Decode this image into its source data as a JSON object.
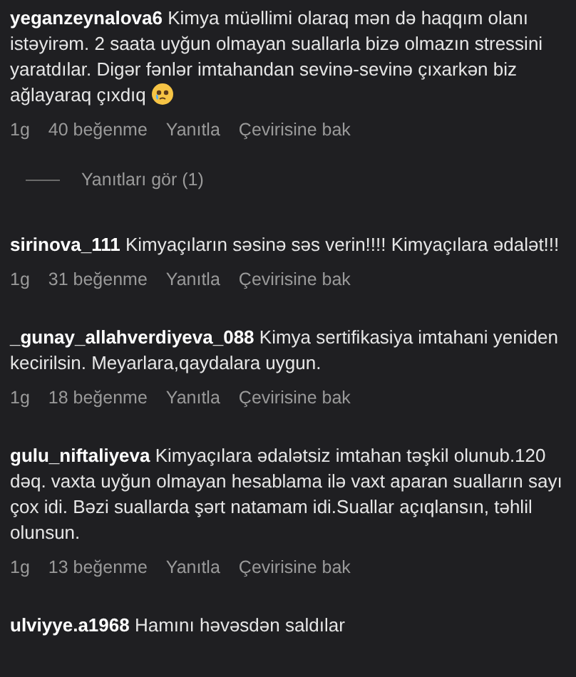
{
  "comments": [
    {
      "username": "yeganzeynalova6",
      "text": "Kimya müəllimi olaraq mən də haqqım olanı istəyirəm. 2 saata uyğun olmayan suallarla bizə olmazın stressini yaratdılar. Digər fənlər imtahandan sevinə-sevinə çıxarkən biz ağlayaraq çıxdıq",
      "trailing_emoji": true,
      "time": "1g",
      "likes": "40 beğenme",
      "reply": "Yanıtla",
      "translate": "Çevirisine bak",
      "replies_link": "Yanıtları gör (1)"
    },
    {
      "username": "sirinova_111",
      "text": "Kimyaçıların səsinə səs verin!!!! Kimyaçılara ədalət!!!",
      "time": "1g",
      "likes": "31 beğenme",
      "reply": "Yanıtla",
      "translate": "Çevirisine bak"
    },
    {
      "username": "_gunay_allahverdiyeva_088",
      "text": "Kimya sertifikasiya imtahani yeniden kecirilsin. Meyarlara,qaydalara uygun.",
      "time": "1g",
      "likes": "18 beğenme",
      "reply": "Yanıtla",
      "translate": "Çevirisine bak"
    },
    {
      "username": "gulu_niftaliyeva",
      "text": "Kimyaçılara ədalətsiz imtahan təşkil olunub.120 dəq. vaxta uyğun olmayan hesablama ilə vaxt aparan sualların sayı çox idi. Bəzi suallarda şərt natamam idi.Suallar açıqlansın, təhlil olunsun.",
      "time": "1g",
      "likes": "13 beğenme",
      "reply": "Yanıtla",
      "translate": "Çevirisine bak"
    },
    {
      "username": "ulviyye.a1968",
      "text": "Hamını həvəsdən saldılar"
    }
  ]
}
